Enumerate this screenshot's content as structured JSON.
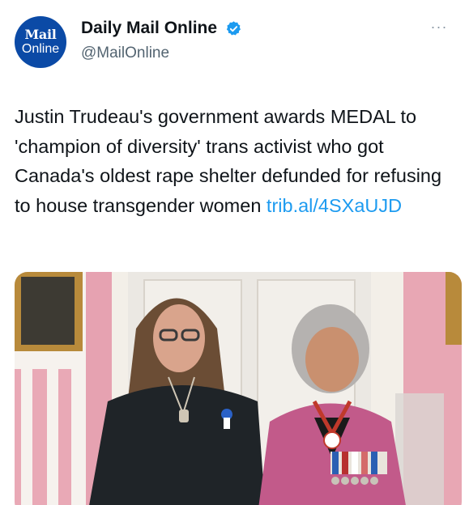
{
  "account": {
    "avatar_line1": "Mail",
    "avatar_line2": "Online",
    "display_name": "Daily Mail Online",
    "handle": "@MailOnline"
  },
  "more_menu": "···",
  "tweet": {
    "text": "Justin Trudeau's government awards MEDAL to 'champion of diversity' trans activist who got Canada's oldest rape shelter defunded for refusing to house transgender women ",
    "link_text": "trib.al/​4SXaUJD"
  },
  "colors": {
    "link": "#1d9bf0",
    "verified_badge": "#1d9bf0",
    "avatar_bg": "#0b4aa6"
  }
}
